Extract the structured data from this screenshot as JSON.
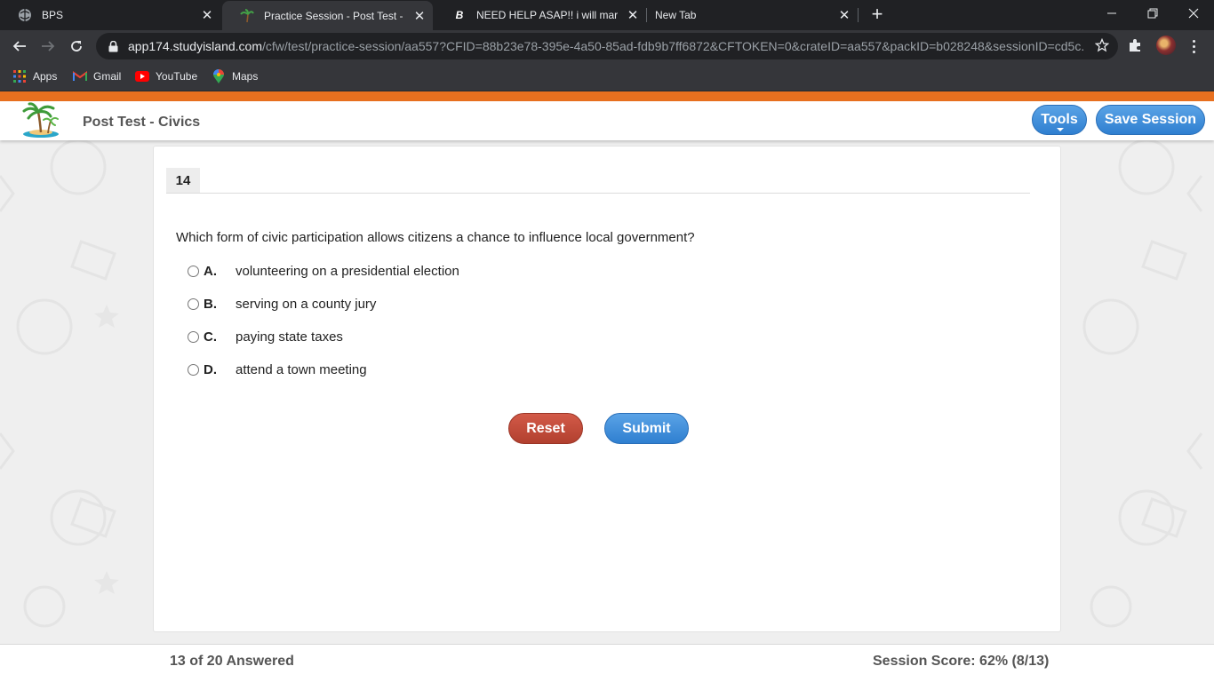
{
  "browser": {
    "tabs": [
      {
        "title": "BPS",
        "favicon": "globe-icon",
        "active": false
      },
      {
        "title": "Practice Session - Post Test - Civics",
        "favicon": "palm-tree-icon",
        "active": true
      },
      {
        "title": "NEED HELP ASAP!! i will mark brainliest",
        "favicon": "brainly-icon",
        "active": false
      },
      {
        "title": "New Tab",
        "favicon": "",
        "active": false
      }
    ],
    "url_host": "app174.studyisland.com",
    "url_path": "/cfw/test/practice-session/aa557?CFID=88b23e78-395e-4a50-85ad-fdb9b7ff6872&CFTOKEN=0&crateID=aa557&packID=b028248&sessionID=cd5c...",
    "bookmarks": [
      {
        "label": "Apps",
        "icon": "apps-grid-icon"
      },
      {
        "label": "Gmail",
        "icon": "gmail-icon"
      },
      {
        "label": "YouTube",
        "icon": "youtube-icon"
      },
      {
        "label": "Maps",
        "icon": "maps-pin-icon"
      }
    ]
  },
  "app": {
    "title": "Post Test - Civics",
    "tools_label": "Tools",
    "save_label": "Save Session"
  },
  "question": {
    "number": "14",
    "text": "Which form of civic participation allows citizens a chance to influence local government?",
    "choices": [
      {
        "letter": "A.",
        "text": "volunteering on a presidential election"
      },
      {
        "letter": "B.",
        "text": "serving on a county jury"
      },
      {
        "letter": "C.",
        "text": "paying state taxes"
      },
      {
        "letter": "D.",
        "text": "attend a town meeting"
      }
    ],
    "reset_label": "Reset",
    "submit_label": "Submit"
  },
  "footer": {
    "answered": "13 of 20 Answered",
    "score": "Session Score: 62% (8/13)"
  },
  "colors": {
    "accent_orange": "#e8701f",
    "button_blue": "#2f7fd0",
    "button_red": "#b2402f"
  }
}
